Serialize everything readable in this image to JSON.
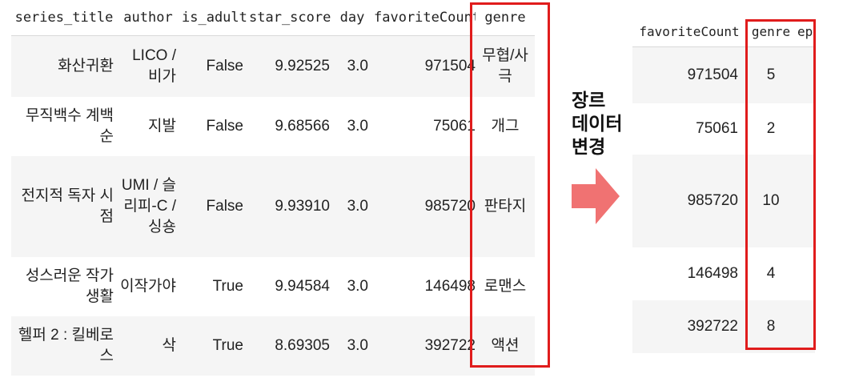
{
  "left_table": {
    "columns": [
      "series_title",
      "author",
      "is_adult",
      "star_score",
      "day",
      "favoriteCount",
      "genre"
    ],
    "rows": [
      [
        "화산귀환",
        "LICO / 비가",
        "False",
        "9.92525",
        "3.0",
        "971504",
        "무협/사극"
      ],
      [
        "무직백수 계백순",
        "지발",
        "False",
        "9.68566",
        "3.0",
        "75061",
        "개그"
      ],
      [
        "전지적 독자 시점",
        "UMI / 슬리피-C / 싱숑",
        "False",
        "9.93910",
        "3.0",
        "985720",
        "판타지"
      ],
      [
        "성스러운 작가생활",
        "이작가야",
        "True",
        "9.94584",
        "3.0",
        "146498",
        "로맨스"
      ],
      [
        "헬퍼 2 : 킬베로스",
        "삭",
        "True",
        "8.69305",
        "3.0",
        "392722",
        "액션"
      ]
    ]
  },
  "annotation": {
    "lines": [
      "장르",
      "데이터",
      "변경"
    ],
    "arrow_color": "#f07272"
  },
  "right_table": {
    "columns": [
      "favoriteCount",
      "genre",
      "ep"
    ],
    "rows": [
      [
        "971504",
        "5",
        ""
      ],
      [
        "75061",
        "2",
        ""
      ],
      [
        "985720",
        "10",
        ""
      ],
      [
        "146498",
        "4",
        ""
      ],
      [
        "392722",
        "8",
        ""
      ]
    ]
  },
  "colors": {
    "highlight_border": "#e01c1c",
    "row_stripe": "#f5f5f5"
  }
}
